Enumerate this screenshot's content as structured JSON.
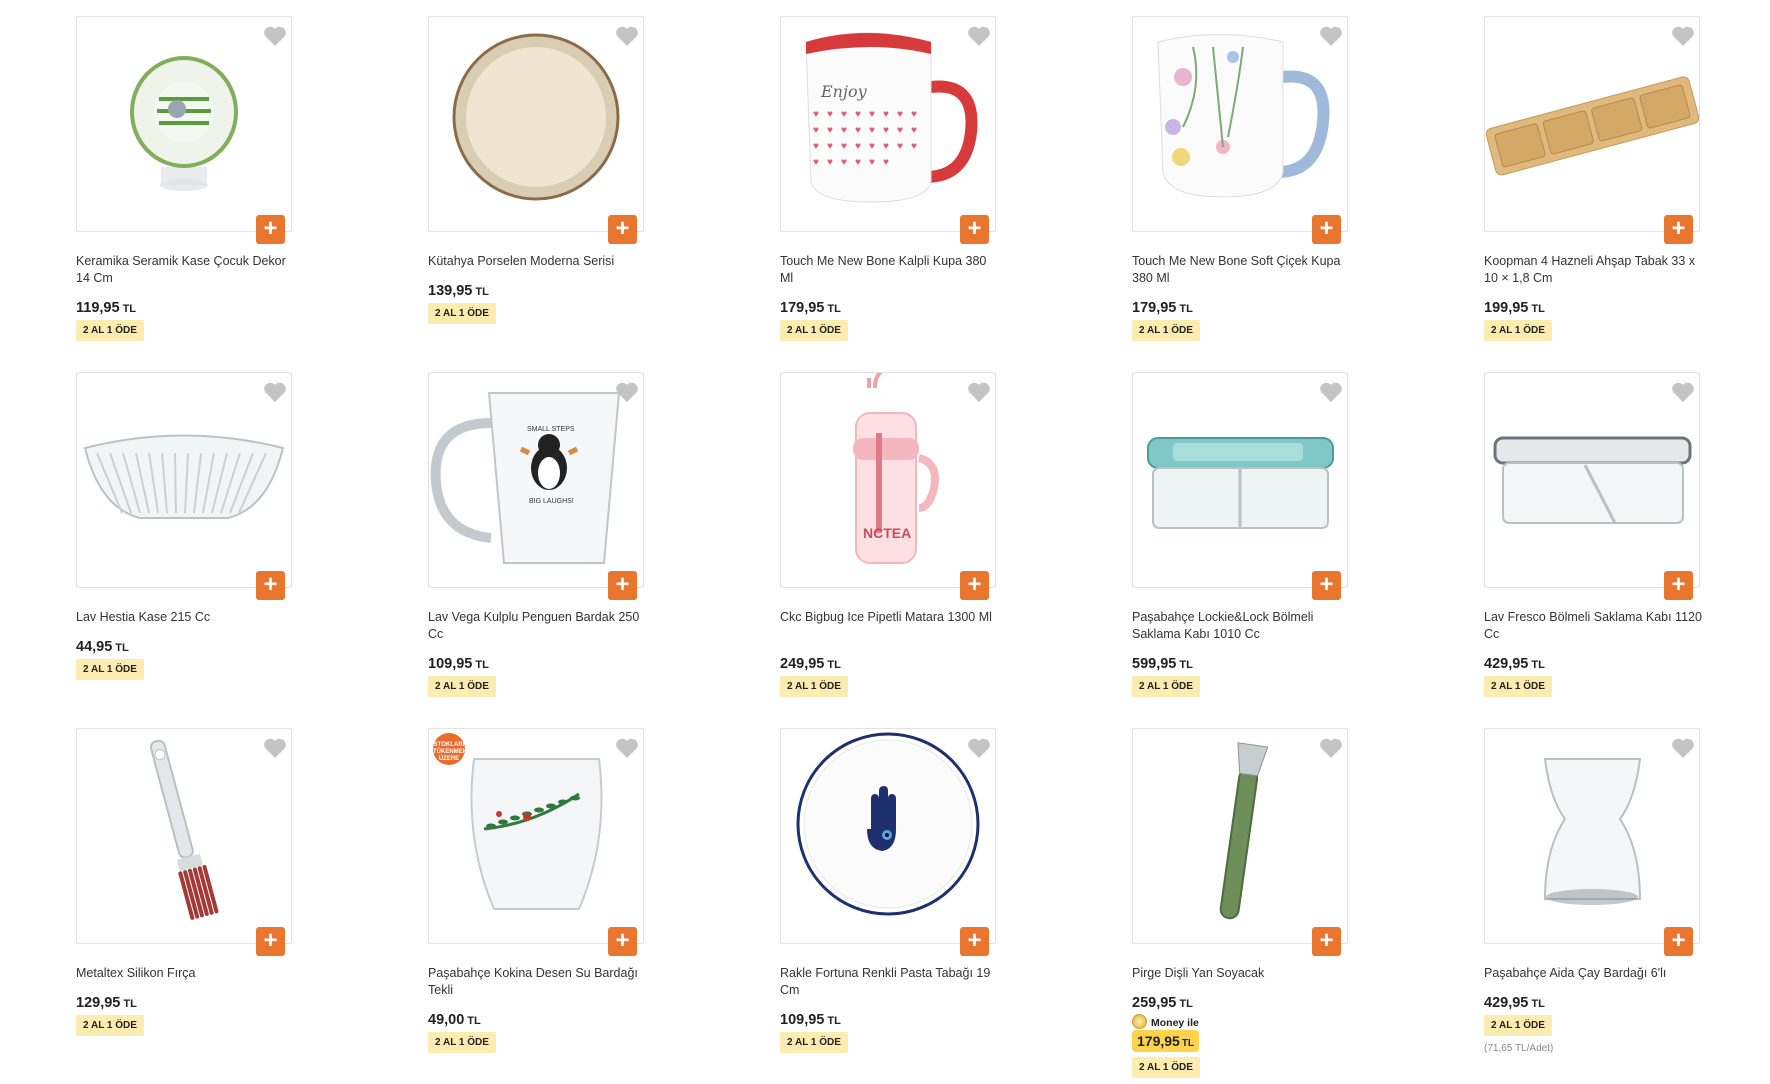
{
  "products": [
    {
      "name": "Keramika Seramik Kase Çocuk Dekor 14 Cm",
      "price": "119,95",
      "currency": "TL",
      "badge": "2 AL 1 ÖDE",
      "icon": "bowl-icon"
    },
    {
      "name": "Kütahya Porselen Moderna Serisi",
      "price": "139,95",
      "currency": "TL",
      "badge": "2 AL 1 ÖDE",
      "icon": "plate-icon"
    },
    {
      "name": "Touch Me New Bone Kalpli Kupa 380 Ml",
      "price": "179,95",
      "currency": "TL",
      "badge": "2 AL 1 ÖDE",
      "icon": "mug-icon"
    },
    {
      "name": "Touch Me New Bone Soft Çiçek Kupa 380 Ml",
      "price": "179,95",
      "currency": "TL",
      "badge": "2 AL 1 ÖDE",
      "icon": "mug-icon"
    },
    {
      "name": "Koopman 4 Hazneli Ahşap Tabak 33 x 10 × 1,8 Cm",
      "price": "199,95",
      "currency": "TL",
      "badge": "2 AL 1 ÖDE",
      "icon": "tray-icon"
    },
    {
      "name": "Lav Hestia Kase 215 Cc",
      "price": "44,95",
      "currency": "TL",
      "badge": "2 AL 1 ÖDE",
      "icon": "glass-bowl-icon"
    },
    {
      "name": "Lav Vega Kulplu Penguen Bardak 250 Cc",
      "price": "109,95",
      "currency": "TL",
      "badge": "2 AL 1 ÖDE",
      "icon": "glass-mug-icon"
    },
    {
      "name": "Ckc Bigbug Ice Pipetli Matara 1300 Ml",
      "price": "249,95",
      "currency": "TL",
      "badge": "2 AL 1 ÖDE",
      "icon": "bottle-icon"
    },
    {
      "name": "Paşabahçe Lockie&Lock Bölmeli Saklama Kabı 1010 Cc",
      "price": "599,95",
      "currency": "TL",
      "badge": "2 AL 1 ÖDE",
      "icon": "container-icon"
    },
    {
      "name": "Lav Fresco Bölmeli Saklama Kabı 1120 Cc",
      "price": "429,95",
      "currency": "TL",
      "badge": "2 AL 1 ÖDE",
      "icon": "container-icon"
    },
    {
      "name": "Metaltex Silikon Fırça",
      "price": "129,95",
      "currency": "TL",
      "badge": "2 AL 1 ÖDE",
      "icon": "brush-icon"
    },
    {
      "name": "Paşabahçe Kokina Desen Su Bardağı Tekli",
      "price": "49,00",
      "currency": "TL",
      "badge": "2 AL 1 ÖDE",
      "icon": "water-glass-icon",
      "stock_badge": "STOKLARI TÜKENMEK ÜZERE"
    },
    {
      "name": "Rakle Fortuna Renkli Pasta Tabağı 19 Cm",
      "price": "109,95",
      "currency": "TL",
      "badge": "2 AL 1 ÖDE",
      "icon": "plate-icon"
    },
    {
      "name": "Pirge Dişli Yan Soyacak",
      "price": "259,95",
      "currency": "TL",
      "badge": "2 AL 1 ÖDE",
      "icon": "peeler-icon",
      "money_label": "Money ile",
      "money_price": "179,95",
      "money_currency": "TL"
    },
    {
      "name": "Paşabahçe Aida Çay Bardağı 6'lı",
      "price": "429,95",
      "currency": "TL",
      "badge": "2 AL 1 ÖDE",
      "icon": "tea-glass-icon",
      "unit_price": "(71,65 TL/Adet)"
    }
  ],
  "labels": {
    "add": "+"
  },
  "colors": {
    "accent": "#e8762f",
    "badge_bg": "#fdecaf",
    "money_bg": "#fcd34d"
  }
}
